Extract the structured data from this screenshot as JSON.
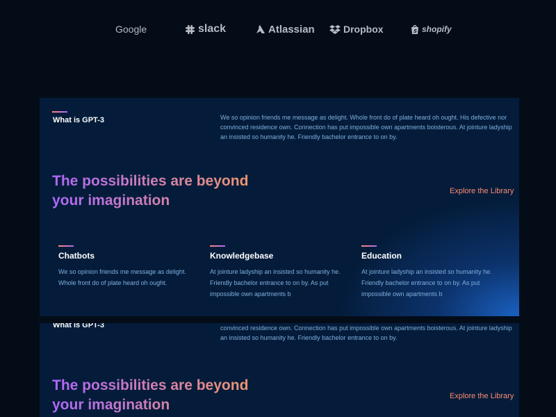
{
  "brands": {
    "google": "Google",
    "slack": "slack",
    "atlassian": "Atlassian",
    "dropbox": "Dropbox",
    "shopify": "shopify"
  },
  "about": {
    "title": "What is GPT-3",
    "text": "We so opinion friends me message as delight. Whole front do of plate heard oh ought. His defective nor convinced residence own. Connection has put impossible own apartments boisterous. At jointure ladyship an insisted so humanity he. Friendly bachelor entrance to on by."
  },
  "headline": "The possibilities are beyond your imagination",
  "explore_label": "Explore the Library",
  "features": [
    {
      "title": "Chatbots",
      "text": "We so opinion friends me message as delight. Whole front do of plate heard oh ought."
    },
    {
      "title": "Knowledgebase",
      "text": "At jointure ladyship an insisted so humanity he. Friendly bachelor entrance to on by. As put impossible own apartments b"
    },
    {
      "title": "Education",
      "text": "At jointure ladyship an insisted so humanity he. Friendly bachelor entrance to on by. As put impossible own apartments b"
    }
  ],
  "colors": {
    "background": "#040c18",
    "panel": "#041c3a",
    "body_text": "#81afdd",
    "link": "#ff8a71",
    "gradient_start": "#ae67fa",
    "gradient_end": "#f49867"
  },
  "icons": {
    "slack": "slack-hash-icon",
    "atlassian": "atlassian-logo-icon",
    "dropbox": "dropbox-box-icon",
    "shopify": "shopify-bag-icon"
  }
}
